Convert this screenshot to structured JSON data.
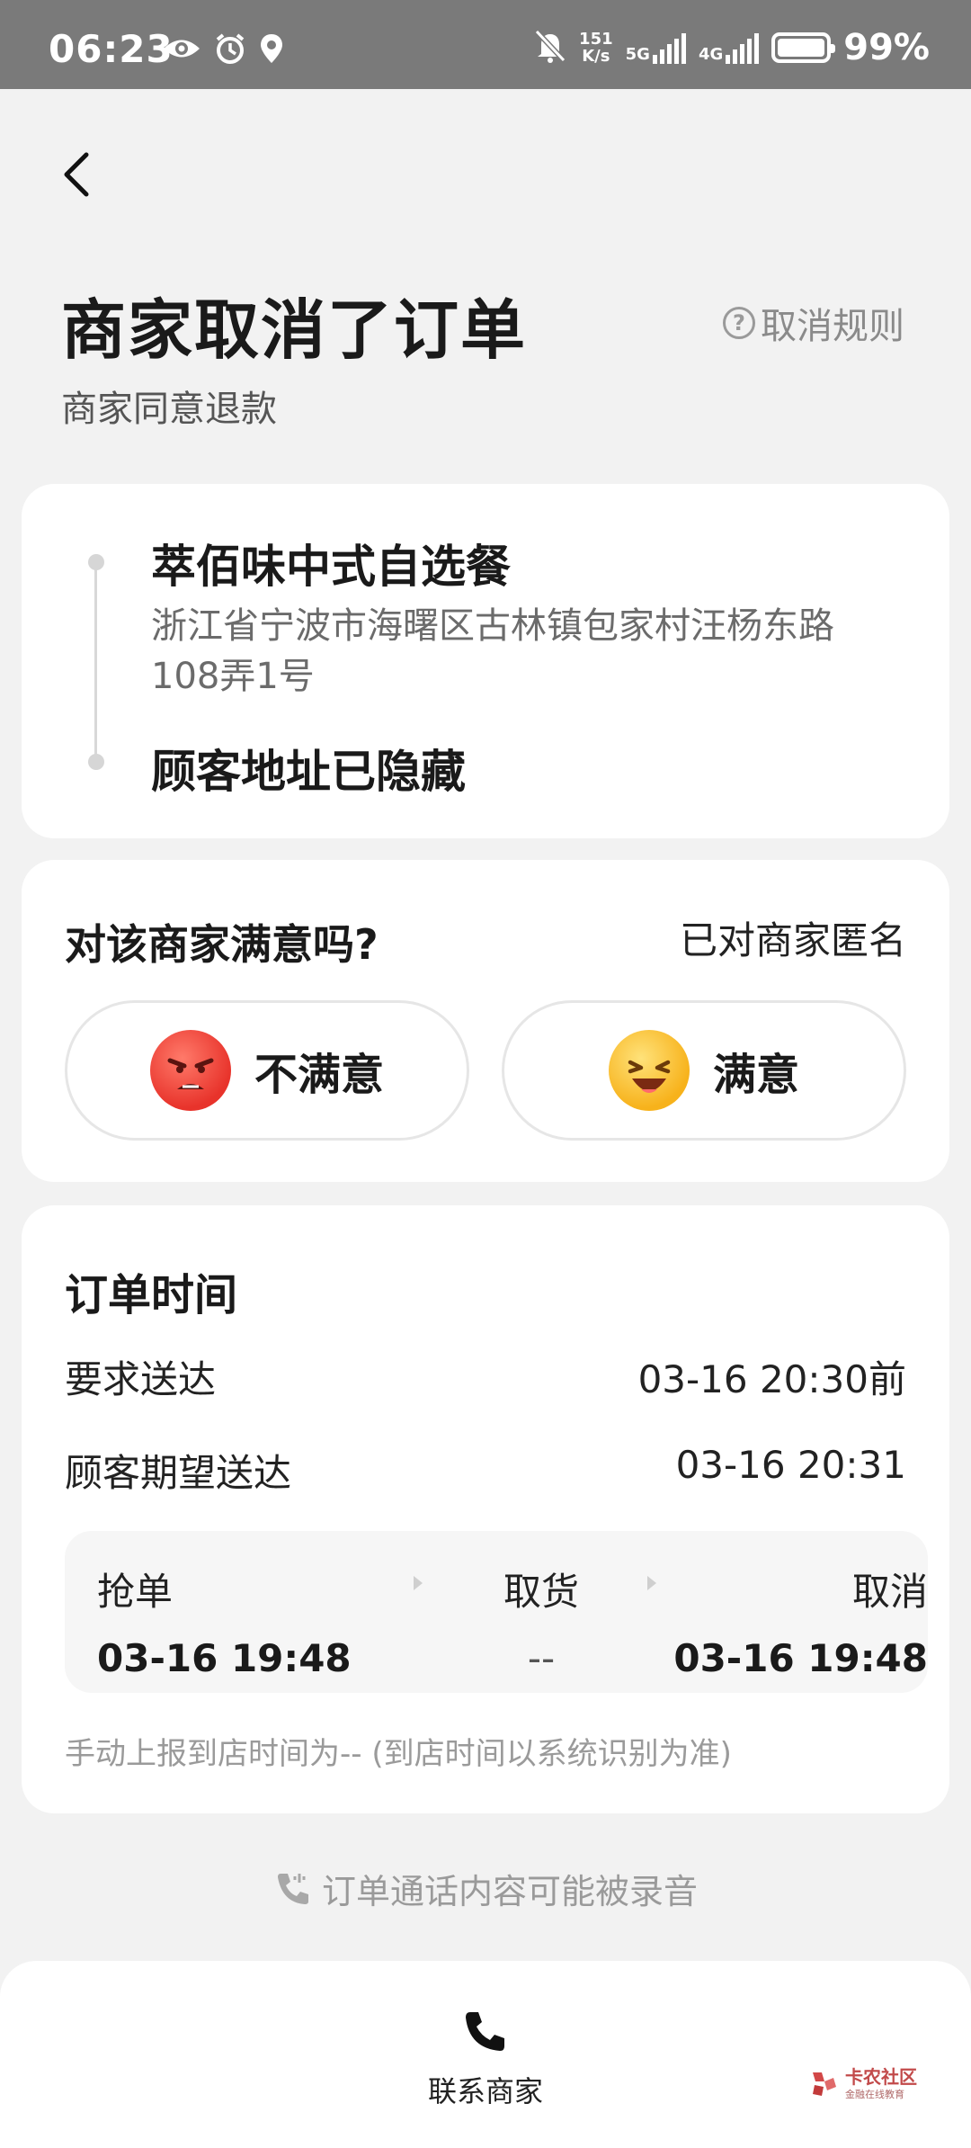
{
  "status_bar": {
    "time": "06:23",
    "net_speed_top": "151",
    "net_speed_bottom": "K/s",
    "sim1_type": "5G",
    "sim2_type": "4G",
    "battery": "99%",
    "icons": [
      "eye-icon",
      "alarm-icon",
      "location-icon",
      "mute-bell-icon",
      "signal-icon",
      "battery-icon"
    ]
  },
  "header": {
    "title": "商家取消了订单",
    "subtitle": "商家同意退款",
    "rules_label": "取消规则"
  },
  "route": {
    "shop_name": "萃佰味中式自选餐",
    "shop_address": "浙江省宁波市海曙区古林镇包家村汪杨东路108弄1号",
    "customer_address": "顾客地址已隐藏"
  },
  "feedback": {
    "question": "对该商家满意吗?",
    "anonymous_note": "已对商家匿名",
    "unsatisfied_label": "不满意",
    "satisfied_label": "满意"
  },
  "order_time": {
    "title": "订单时间",
    "required_label": "要求送达",
    "required_value": "03-16 20:30前",
    "expected_label": "顾客期望送达",
    "expected_value": "03-16 20:31",
    "timeline": [
      {
        "label": "抢单",
        "time": "03-16 19:48"
      },
      {
        "label": "取货",
        "time": "--"
      },
      {
        "label": "取消",
        "time": "03-16 19:48"
      }
    ],
    "manual_note": "手动上报到店时间为-- (到店时间以系统识别为准)"
  },
  "recording_note": "订单通话内容可能被录音",
  "bottom": {
    "contact_label": "联系商家",
    "watermark_text": "卡农社区",
    "watermark_sub": "金融在线教育"
  },
  "colors": {
    "background": "#f2f2f2",
    "card": "#ffffff",
    "muted_text": "#9a9a9a"
  }
}
